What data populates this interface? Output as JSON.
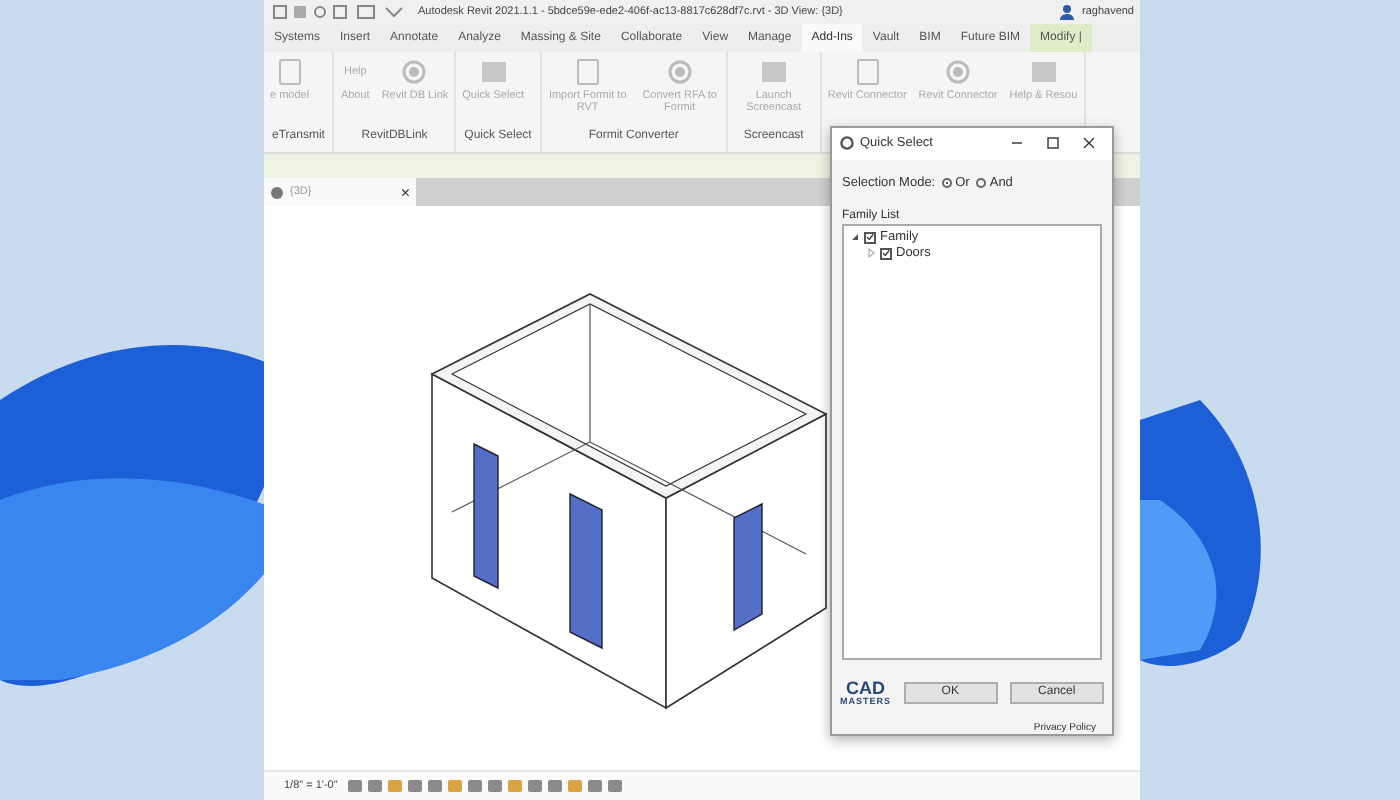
{
  "window": {
    "title": "Autodesk Revit 2021.1.1 - 5bdce59e-ede2-406f-ac13-8817c628df7c.rvt - 3D View: {3D}",
    "user": "raghavend"
  },
  "ribbon_tabs": [
    {
      "label": "Systems",
      "selected": false
    },
    {
      "label": "Insert",
      "selected": false
    },
    {
      "label": "Annotate",
      "selected": false
    },
    {
      "label": "Analyze",
      "selected": false
    },
    {
      "label": "Massing & Site",
      "selected": false
    },
    {
      "label": "Collaborate",
      "selected": false
    },
    {
      "label": "View",
      "selected": false
    },
    {
      "label": "Manage",
      "selected": false
    },
    {
      "label": "Add-Ins",
      "selected": true
    },
    {
      "label": "Vault",
      "selected": false
    },
    {
      "label": "BIM",
      "selected": false
    },
    {
      "label": "Future BIM",
      "selected": false
    },
    {
      "label": "Modify |",
      "selected": false,
      "kind": "contextual"
    }
  ],
  "ribbon_panels": [
    {
      "label": "eTransmit",
      "buttons": [
        {
          "label": "e model"
        }
      ]
    },
    {
      "label": "RevitDBLink",
      "buttons": [
        {
          "caption": "Help",
          "label": "About"
        },
        {
          "label": "Revit DB Link"
        }
      ]
    },
    {
      "label": "Quick Select",
      "buttons": [
        {
          "label": "Quick Select"
        }
      ]
    },
    {
      "label": "Formit Converter",
      "buttons": [
        {
          "label": "Import Formit to RVT"
        },
        {
          "label": "Convert RFA to Formit"
        }
      ]
    },
    {
      "label": "Screencast",
      "buttons": [
        {
          "label": "Launch Screencast"
        }
      ]
    },
    {
      "buttons": [
        {
          "label": "Revit Connector"
        },
        {
          "label": "Revit Connector"
        },
        {
          "label": "Help & Resou"
        }
      ]
    }
  ],
  "view_tab": {
    "label": "{3D}",
    "close": "×"
  },
  "status_bar": {
    "scale": "1/8\" = 1'-0\""
  },
  "dialog": {
    "title": "Quick Select",
    "selection_mode_label": "Selection Mode:",
    "modes": [
      {
        "label": "Or",
        "selected": true
      },
      {
        "label": "And",
        "selected": false
      }
    ],
    "family_list_label": "Family List",
    "tree": [
      {
        "label": "Family",
        "checked": true,
        "expanded": true,
        "children": [
          {
            "label": "Doors",
            "checked": true,
            "expanded": false
          }
        ]
      }
    ],
    "logo": {
      "line_1": "CAD",
      "line_2": "MASTERS"
    },
    "buttons": [
      "OK",
      "Cancel"
    ],
    "link": "Privacy Policy"
  }
}
